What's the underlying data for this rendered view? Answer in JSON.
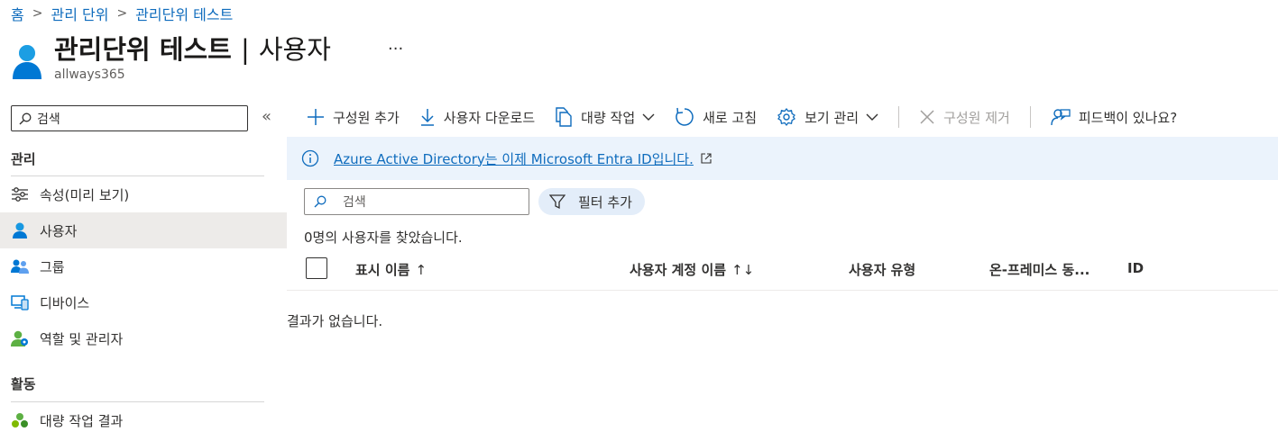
{
  "breadcrumb": {
    "home": "홈",
    "level1": "관리 단위",
    "level2": "관리단위 테스트"
  },
  "header": {
    "title": "관리단위 테스트",
    "separator": "|",
    "page": "사용자",
    "subtitle": "allways365",
    "more": "···"
  },
  "sidebar": {
    "search_placeholder": "검색",
    "collapse": "«",
    "sections": [
      {
        "title": "관리",
        "items": [
          {
            "label": "속성(미리 보기)",
            "icon": "sliders-icon"
          },
          {
            "label": "사용자",
            "icon": "user-icon",
            "active": true
          },
          {
            "label": "그룹",
            "icon": "group-icon"
          },
          {
            "label": "디바이스",
            "icon": "devices-icon"
          },
          {
            "label": "역할 및 관리자",
            "icon": "roles-icon"
          }
        ]
      },
      {
        "title": "활동",
        "items": [
          {
            "label": "대량 작업 결과",
            "icon": "bulk-results-icon"
          }
        ]
      }
    ]
  },
  "toolbar": {
    "add_member": "구성원 추가",
    "download_users": "사용자 다운로드",
    "bulk_operations": "대량 작업",
    "refresh": "새로 고침",
    "manage_view": "보기 관리",
    "remove_member": "구성원 제거",
    "feedback": "피드백이 있나요?"
  },
  "banner": {
    "text": "Azure Active Directory는 이제 Microsoft Entra ID입니다."
  },
  "filter": {
    "search_placeholder": "검색",
    "add_filter": "필터 추가"
  },
  "results": {
    "count_text": "0명의 사용자를 찾았습니다.",
    "empty_text": "결과가 없습니다."
  },
  "table": {
    "columns": [
      {
        "label": "표시 이름",
        "sort": "↑"
      },
      {
        "label": "사용자 계정 이름",
        "sort": "↑↓"
      },
      {
        "label": "사용자 유형",
        "sort": ""
      },
      {
        "label": "온-프레미스 동...",
        "sort": ""
      },
      {
        "label": "ID",
        "sort": ""
      }
    ]
  },
  "colors": {
    "accent": "#0f6cbd",
    "banner_bg": "#ebf3fc",
    "active_nav_bg": "#edebe9"
  }
}
